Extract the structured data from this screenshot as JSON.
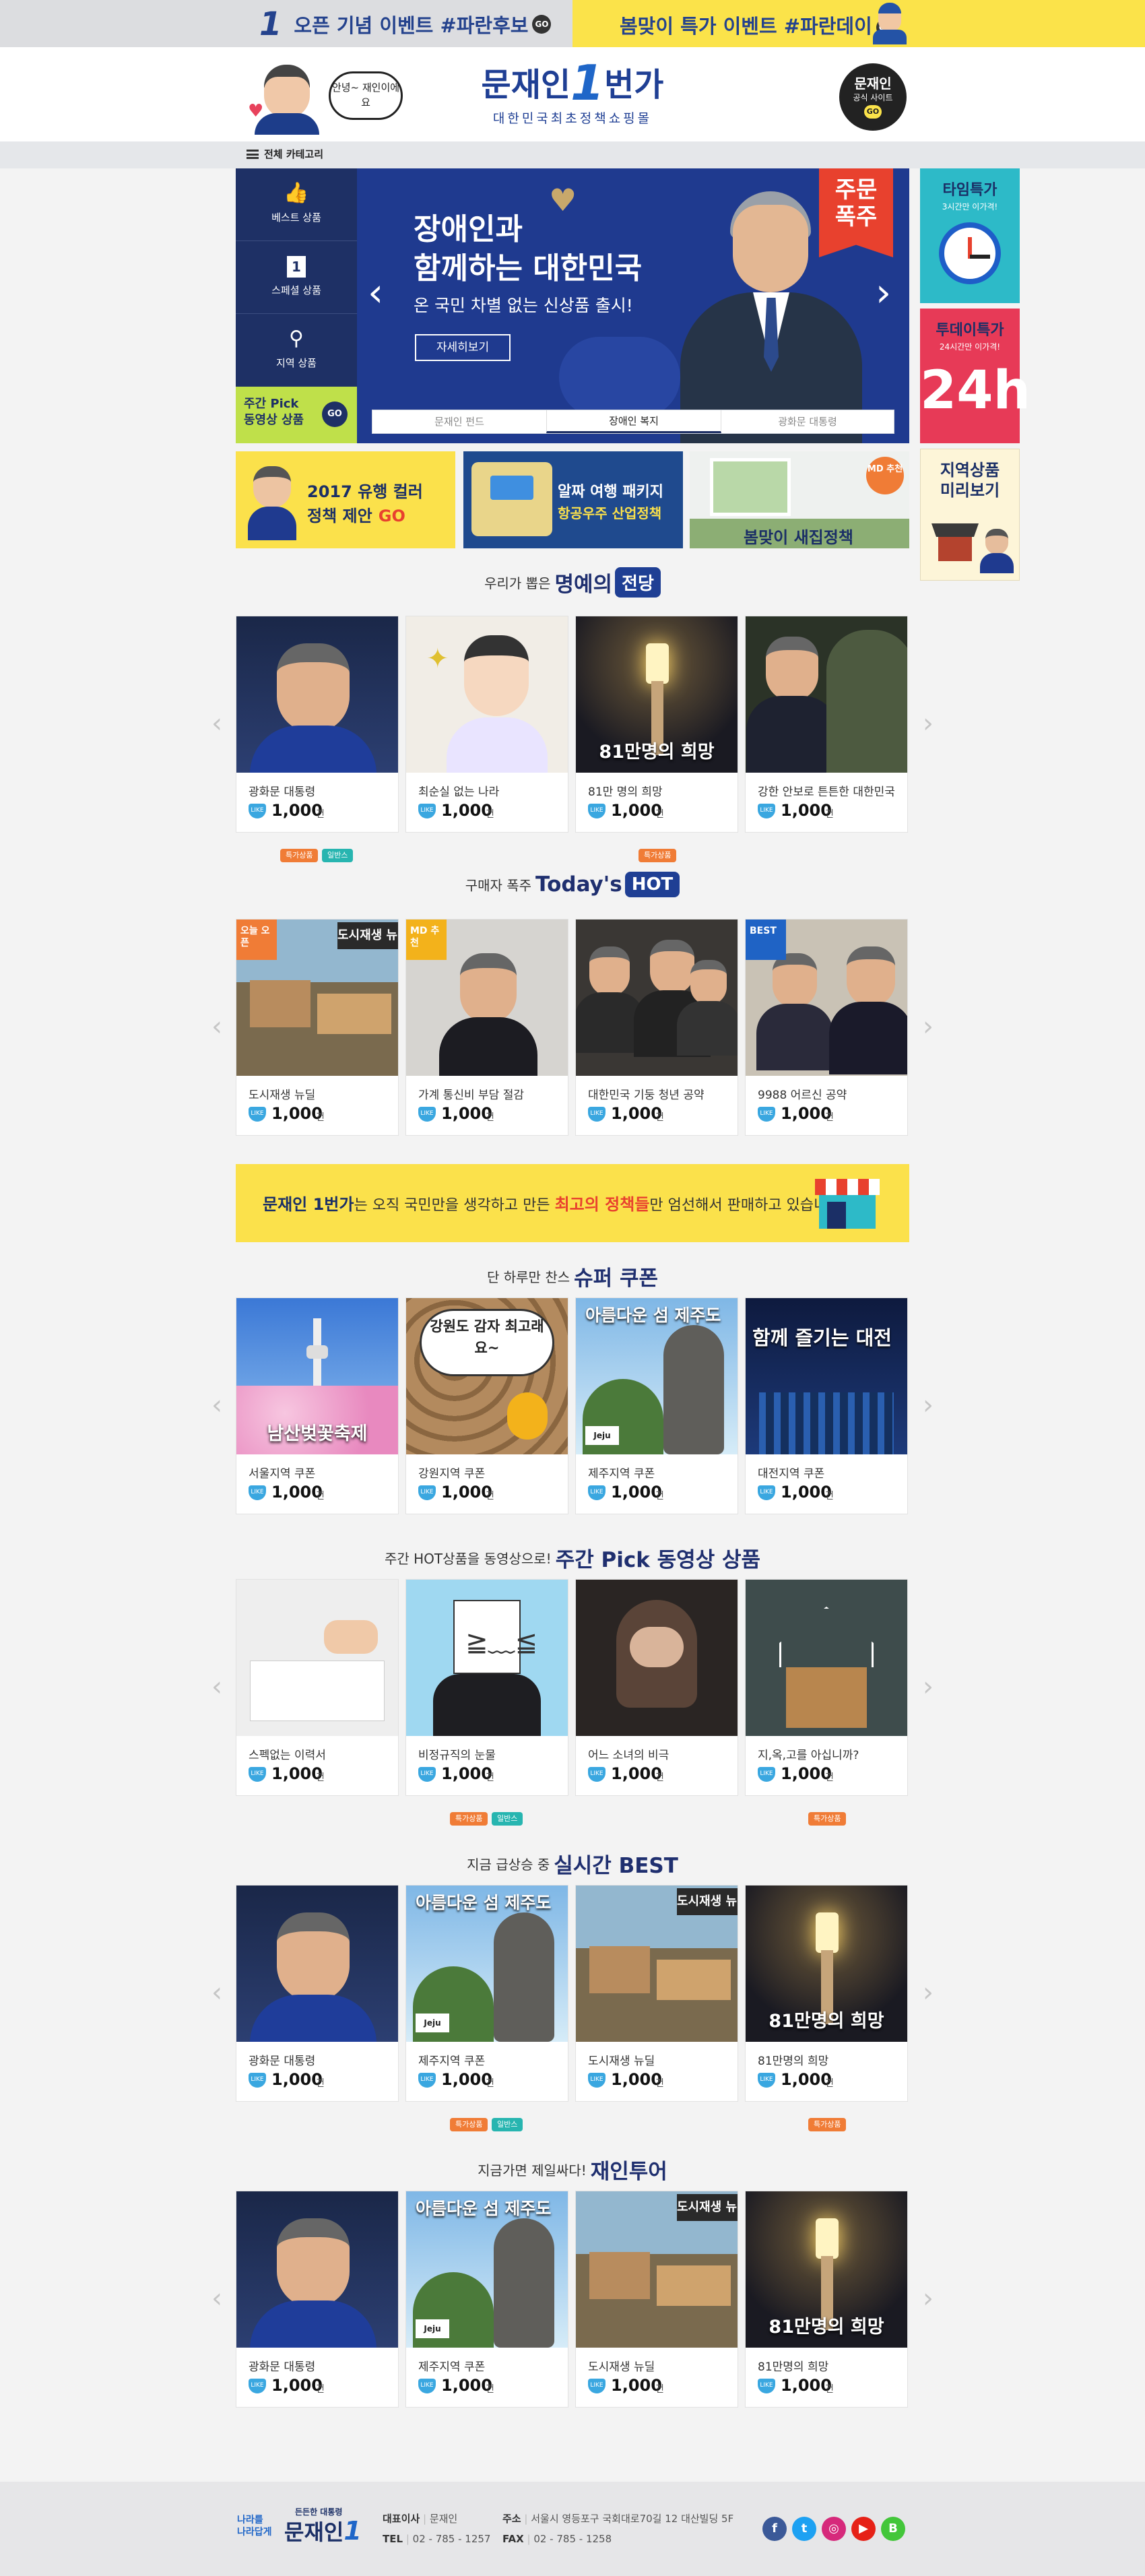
{
  "topbar": {
    "event1_num": "1",
    "event1_text": "오픈 기념 이벤트 #파란후보",
    "event2_text": "봄맞이 특가 이벤트 #파란데이",
    "go": "GO"
  },
  "header": {
    "speech": "안녕~ 재인이에요",
    "brand_name": "문재인",
    "brand_num": "1",
    "brand_suffix": "번가",
    "brand_sub": "대한민국최초정책쇼핑몰",
    "official_line1": "문재인",
    "official_line2": "공식 사이트",
    "go": "GO"
  },
  "category": {
    "label": "전체 카테고리"
  },
  "sidemenu": [
    {
      "label": "베스트 상품"
    },
    {
      "label": "스페셜 상품"
    },
    {
      "label": "지역 상품"
    }
  ],
  "weekly_pick": {
    "line1": "주간 Pick",
    "line2": "동영상 상품",
    "go": "GO"
  },
  "hero": {
    "title_line1": "장애인과",
    "title_line2": "함께하는 대한민국",
    "subtitle": "온 국민 차별 없는 신상품 출시!",
    "detail_button": "자세히보기",
    "corner_line1": "주문",
    "corner_line2": "폭주",
    "tabs": [
      "문재인 펀드",
      "장애인 복지",
      "광화문 대통령"
    ],
    "active_tab": 1
  },
  "promos": [
    {
      "line1": "2017 유행 컬러",
      "line2": "정책 제안",
      "go": "GO"
    },
    {
      "line1": "알짜 여행 패키지",
      "line2": "항공우주 산업정책"
    },
    {
      "line1": "봄맞이 새집정책",
      "corner": "MD 추천"
    }
  ],
  "right_banners": [
    {
      "title": "타임특가",
      "sub": "3시간만 이가격!"
    },
    {
      "title": "투데이특가",
      "sub": "24시간만 이가격!",
      "big": "24h"
    },
    {
      "title": "지역상품",
      "title2": "미리보기"
    }
  ],
  "sections": [
    {
      "sub": "우리가 뽑은",
      "main": "명예의",
      "emblem": "전당",
      "items": [
        {
          "name": "광화문 대통령",
          "count": "1,000",
          "img": "portrait"
        },
        {
          "name": "최순실 없는 나라",
          "count": "1,000",
          "img": "cartoon"
        },
        {
          "name": "81만 명의 희망",
          "count": "1,000",
          "img": "candle",
          "caption": "81만명의 희망"
        },
        {
          "name": "강한 안보로 튼튼한 대한민국",
          "count": "1,000",
          "img": "military"
        }
      ],
      "badges": [
        [
          "특가상품",
          "일반스"
        ],
        [],
        [
          "특가상품"
        ],
        []
      ]
    },
    {
      "sub": "구매자 폭주",
      "main": "Today's",
      "emblem": "HOT",
      "items": [
        {
          "name": "도시재생 뉴딜",
          "count": "1,000",
          "img": "construction",
          "tag": "오늘 오픈",
          "tagcolor": "#f07c36",
          "caption": "도시재생 뉴딜"
        },
        {
          "name": "가계 통신비 부담 절감",
          "count": "1,000",
          "img": "press",
          "tag": "MD 추천",
          "tagcolor": "#f3b21b"
        },
        {
          "name": "대한민국 기둥 청년 공약",
          "count": "1,000",
          "img": "crowd"
        },
        {
          "name": "9988 어르신 공약",
          "count": "1,000",
          "img": "elders",
          "tag": "BEST",
          "tagcolor": "#1f63c5"
        }
      ],
      "badges": [
        [],
        [],
        [],
        []
      ]
    },
    {
      "sub": "단 하루만 찬스",
      "main": "슈퍼 쿠폰",
      "emblem": "",
      "items": [
        {
          "name": "서울지역 쿠폰",
          "count": "1,000",
          "img": "seoul",
          "caption": "남산벚꽃축제"
        },
        {
          "name": "강원지역 쿠폰",
          "count": "1,000",
          "img": "potato",
          "caption": "강원도 감자 최고래요~"
        },
        {
          "name": "제주지역 쿠폰",
          "count": "1,000",
          "img": "jeju",
          "caption": "아름다운 섬 제주도"
        },
        {
          "name": "대전지역 쿠폰",
          "count": "1,000",
          "img": "daejeon",
          "caption": "함께 즐기는 대전"
        }
      ],
      "badges": [
        [],
        [],
        [],
        []
      ]
    },
    {
      "sub": "주간 HOT상품을 동영상으로!",
      "main": "주간 Pick 동영상 상품",
      "emblem": "",
      "items": [
        {
          "name": "스펙없는 이력서",
          "count": "1,000",
          "img": "writing"
        },
        {
          "name": "비정규직의 눈물",
          "count": "1,000",
          "img": "crying"
        },
        {
          "name": "어느 소녀의 비극",
          "count": "1,000",
          "img": "girl"
        },
        {
          "name": "지,옥,고를 아십니까?",
          "count": "1,000",
          "img": "box"
        }
      ],
      "badges": [
        [],
        [
          "특가상품",
          "일반스"
        ],
        [],
        [
          "특가상품"
        ]
      ]
    },
    {
      "sub": "지금 급상승 중",
      "main": "실시간 BEST",
      "emblem": "",
      "items": [
        {
          "name": "광화문 대통령",
          "count": "1,000",
          "img": "portrait"
        },
        {
          "name": "제주지역 쿠폰",
          "count": "1,000",
          "img": "jeju",
          "caption": "아름다운 섬 제주도"
        },
        {
          "name": "도시재생 뉴딜",
          "count": "1,000",
          "img": "construction",
          "caption": "도시재생 뉴딜"
        },
        {
          "name": "81만명의 희망",
          "count": "1,000",
          "img": "candle",
          "caption": "81만명의 희망"
        }
      ],
      "badges": [
        [],
        [
          "특가상품",
          "일반스"
        ],
        [],
        [
          "특가상품"
        ]
      ]
    },
    {
      "sub": "지금가면 제일싸다!",
      "main": "재인투어",
      "emblem": "",
      "items": [
        {
          "name": "광화문 대통령",
          "count": "1,000",
          "img": "portrait"
        },
        {
          "name": "제주지역 쿠폰",
          "count": "1,000",
          "img": "jeju",
          "caption": "아름다운 섬 제주도"
        },
        {
          "name": "도시재생 뉴딜",
          "count": "1,000",
          "img": "construction",
          "caption": "도시재생 뉴딜"
        },
        {
          "name": "81만명의 희망",
          "count": "1,000",
          "img": "candle",
          "caption": "81만명의 희망"
        }
      ],
      "badges": [
        [],
        [],
        [],
        []
      ]
    }
  ],
  "like_label": "LIKE",
  "unit": "건",
  "notice": {
    "brand": "문재인 1번가",
    "text1": "는 오직 국민만을 생각하고 만든 ",
    "highlight": "최고의 정책들",
    "text2": "만 엄선해서 판매하고 있습니다."
  },
  "footer": {
    "slogan1": "나라를",
    "slogan2": "나라답게",
    "brand_small": "든든한 대통령",
    "brand": "문재인",
    "brand_num": "1",
    "ceo_label": "대표이사",
    "ceo": "문재인",
    "address_label": "주소",
    "address": "서울시 영등포구 국회대로70길 12 대산빌딩 5F",
    "tel_label": "TEL",
    "tel": "02 - 785 - 1257",
    "fax_label": "FAX",
    "fax": "02 - 785 - 1258",
    "social": [
      {
        "name": "facebook",
        "glyph": "f",
        "color": "#3b5998"
      },
      {
        "name": "twitter",
        "glyph": "t",
        "color": "#1da1f2"
      },
      {
        "name": "instagram",
        "glyph": "◎",
        "color": "#d6297b"
      },
      {
        "name": "youtube",
        "glyph": "▶",
        "color": "#e62117"
      },
      {
        "name": "blog",
        "glyph": "B",
        "color": "#43c63a"
      }
    ]
  }
}
